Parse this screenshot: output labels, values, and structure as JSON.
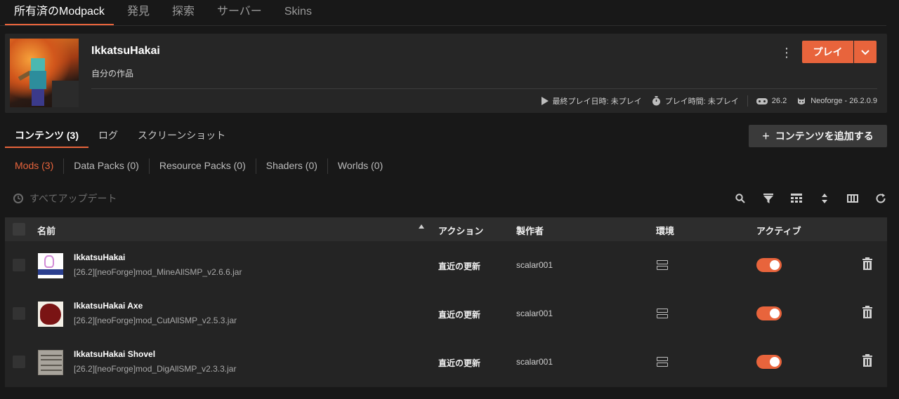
{
  "nav": {
    "tabs": [
      "所有済のModpack",
      "発見",
      "探索",
      "サーバー",
      "Skins"
    ]
  },
  "instance": {
    "name": "IkkatsuHakai",
    "subtitle": "自分の作品",
    "last_played": "最終プレイ日時: 未プレイ",
    "play_time": "プレイ時間: 未プレイ",
    "mc_version": "26.2",
    "loader": "Neoforge - 26.2.0.9",
    "play_label": "プレイ",
    "kebab_glyph": "⋮",
    "drop_glyph": "⌄"
  },
  "content_tabs": [
    "コンテンツ (3)",
    "ログ",
    "スクリーンショット"
  ],
  "add_content_label": "コンテンツを追加する",
  "add_content_plus": "+",
  "filters": [
    "Mods (3)",
    "Data Packs (0)",
    "Resource Packs (0)",
    "Shaders (0)",
    "Worlds (0)"
  ],
  "update_all_label": "すべてアップデート",
  "toolbar_icons": [
    "search-icon",
    "filter-icon",
    "grid-icon",
    "sort-icon",
    "columns-icon",
    "refresh-icon"
  ],
  "table": {
    "headers": {
      "name": "名前",
      "action": "アクション",
      "author": "製作者",
      "env": "環境",
      "active": "アクティブ"
    },
    "rows": [
      {
        "title": "IkkatsuHakai",
        "file": "[26.2][neoForge]mod_MineAllSMP_v2.6.6.jar",
        "action": "直近の更新",
        "author": "scalar001",
        "active": true
      },
      {
        "title": "IkkatsuHakai Axe",
        "file": "[26.2][neoForge]mod_CutAllSMP_v2.5.3.jar",
        "action": "直近の更新",
        "author": "scalar001",
        "active": true
      },
      {
        "title": "IkkatsuHakai Shovel",
        "file": "[26.2][neoForge]mod_DigAllSMP_v2.3.3.jar",
        "action": "直近の更新",
        "author": "scalar001",
        "active": true
      }
    ]
  },
  "colors": {
    "accent": "#e8643c",
    "background": "#181818",
    "panel": "#262626"
  }
}
